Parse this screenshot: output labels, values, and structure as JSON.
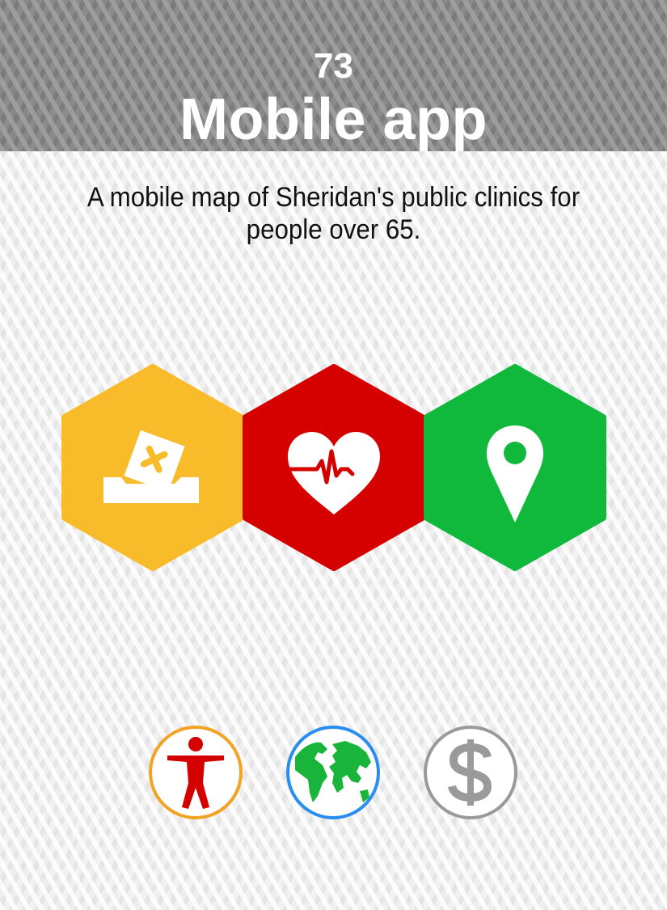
{
  "card": {
    "number": "73",
    "title": "Mobile app",
    "description": "A mobile map of Sheridan's public clinics for people over 65."
  },
  "icons": {
    "hexagons": [
      {
        "icon": "ballot-box-icon",
        "color": "#f8bc2b"
      },
      {
        "icon": "heartbeat-icon",
        "color": "#d50000"
      },
      {
        "icon": "map-pin-icon",
        "color": "#10b93c"
      }
    ],
    "badges": [
      {
        "icon": "accessibility-person-icon",
        "ring_color": "#f2a324",
        "icon_color": "#d50000"
      },
      {
        "icon": "globe-icon",
        "ring_color": "#2a8ef0",
        "icon_color": "#18b53a"
      },
      {
        "icon": "dollar-icon",
        "ring_color": "#9a9a9a",
        "icon_color": "#9a9a9a"
      }
    ]
  },
  "colors": {
    "header_bg": "#8c8c8c",
    "title_text": "#ffffff",
    "body_text": "#111111"
  }
}
